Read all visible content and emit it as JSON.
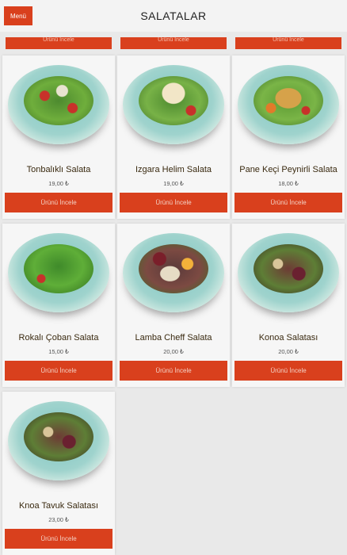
{
  "header": {
    "menu_label": "Menü",
    "title": "SALATALAR"
  },
  "top_strip": {
    "button_label": "Ürünü İncele"
  },
  "products": [
    {
      "name": "Tonbalıklı Salata",
      "price": "19,00 ₺",
      "button": "Ürünü İncele"
    },
    {
      "name": "Izgara Helim Salata",
      "price": "19,00 ₺",
      "button": "Ürünü İncele"
    },
    {
      "name": "Pane Keçi Peynirli Salata",
      "price": "18,00 ₺",
      "button": "Ürünü İncele"
    },
    {
      "name": "Rokalı Çoban Salata",
      "price": "15,00 ₺",
      "button": "Ürünü İncele"
    },
    {
      "name": "Lamba Cheff Salata",
      "price": "20,00 ₺",
      "button": "Ürünü İncele"
    },
    {
      "name": "Konoa Salatası",
      "price": "20,00 ₺",
      "button": "Ürünü İncele"
    },
    {
      "name": "Knoa Tavuk Salatası",
      "price": "23,00 ₺",
      "button": "Ürünü İncele"
    }
  ],
  "colors": {
    "accent": "#d9401d",
    "background": "#e9e9e9"
  }
}
